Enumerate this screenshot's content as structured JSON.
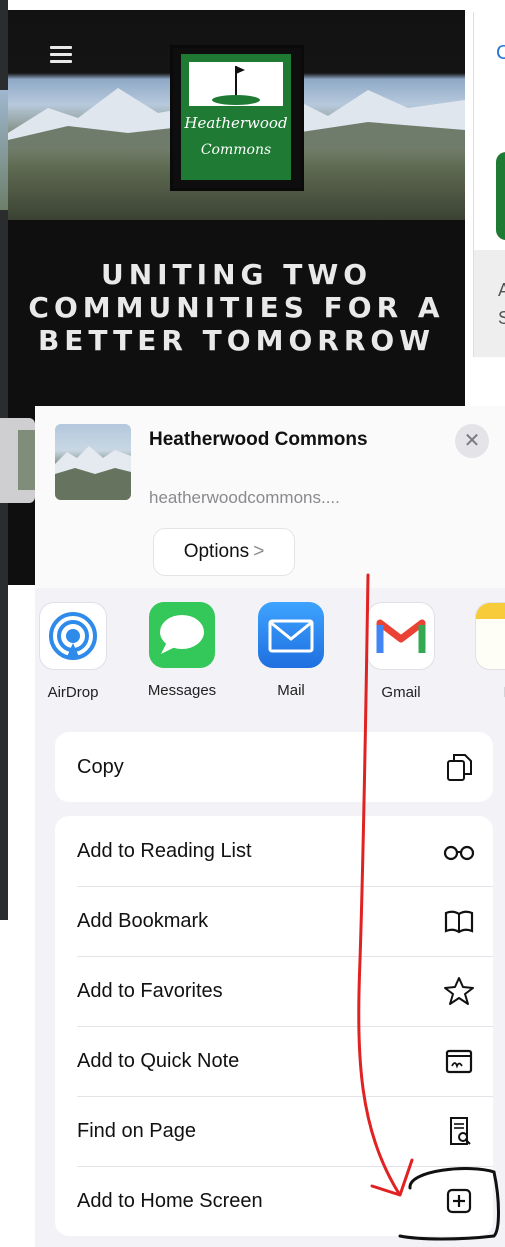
{
  "website": {
    "logo_line1": "Heatherwood",
    "logo_line2": "Commons",
    "headline": "UNITING TWO COMMUNITIES FOR A BETTER TOMORROW",
    "peek_letter": "C",
    "peek_text_1": "A",
    "peek_text_2": "S"
  },
  "share_sheet": {
    "title": "Heatherwood Commons",
    "url": "heatherwoodcommons....",
    "options_label": "Options",
    "close_icon": "close-icon",
    "apps": [
      {
        "label": "AirDrop",
        "icon": "airdrop-icon"
      },
      {
        "label": "Messages",
        "icon": "messages-icon"
      },
      {
        "label": "Mail",
        "icon": "mail-icon"
      },
      {
        "label": "Gmail",
        "icon": "gmail-icon"
      },
      {
        "label": "N",
        "icon": "notes-icon"
      }
    ],
    "actions": {
      "copy": "Copy",
      "reading_list": "Add to Reading List",
      "bookmark": "Add Bookmark",
      "favorites": "Add to Favorites",
      "quick_note": "Add to Quick Note",
      "find": "Find on Page",
      "home_screen": "Add to Home Screen"
    }
  },
  "colors": {
    "sheet_bg": "#f2f2f7",
    "logo_green": "#1f7a34",
    "annotation_red": "#e02222"
  }
}
